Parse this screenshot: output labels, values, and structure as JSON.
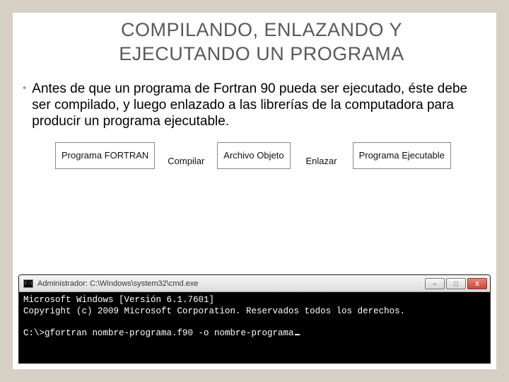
{
  "title": "COMPILANDO, ENLAZANDO Y EJECUTANDO UN PROGRAMA",
  "bullet": {
    "marker": "•",
    "text": "Antes de que un programa de Fortran 90 pueda ser ejecutado, éste debe ser compilado, y luego enlazado a las librerías de la computadora para producir un programa ejecutable."
  },
  "flow": {
    "box1": "Programa FORTRAN",
    "step1": "Compilar",
    "box2": "Archivo Objeto",
    "step2": "Enlazar",
    "box3": "Programa Ejecutable"
  },
  "window": {
    "title": "Administrador: C:\\Windows\\system32\\cmd.exe",
    "min_glyph": "–",
    "max_glyph": "□",
    "close_glyph": "X"
  },
  "console": {
    "line1": "Microsoft Windows [Versión 6.1.7601]",
    "line2": "Copyright (c) 2009 Microsoft Corporation. Reservados todos los derechos.",
    "blank": "",
    "line3": "C:\\>gfortran nombre-programa.f90 -o nombre-programa"
  }
}
